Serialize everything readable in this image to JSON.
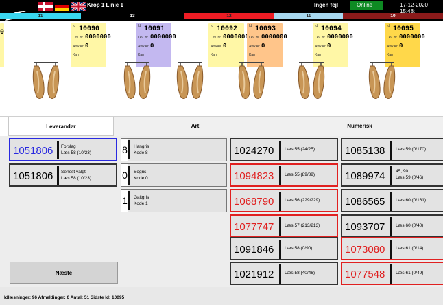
{
  "header": {
    "line_title": "Krop 1 Linie 1",
    "status": "Ingen fejl",
    "online": "Online",
    "datetime": "17-12-2020 15:48:",
    "segments": [
      "11",
      "13",
      "12",
      "11",
      "10"
    ],
    "colors": {
      "cyan": "#3ad6f0",
      "black": "#000000",
      "red": "#ee1c24",
      "light_blue": "#a8d8ef",
      "dark_red": "#8b1a1a",
      "online": "#0e8a23"
    }
  },
  "cards": [
    {
      "id": "10090",
      "lev": "0000000",
      "afskaer": "0",
      "kan": "",
      "color": "#fff7a6",
      "label_id": "Id",
      "label_lev": "Lev. nr",
      "label_afsk": "Afskær",
      "label_kan": "Kan"
    },
    {
      "id": "10091",
      "lev": "0000000",
      "afskaer": "0",
      "kan": "",
      "color": "#c3b8f0",
      "label_id": "Id",
      "label_lev": "Lev. nr",
      "label_afsk": "Afskær",
      "label_kan": "Kan"
    },
    {
      "id": "10092",
      "lev": "0000000",
      "afskaer": "0",
      "kan": "",
      "color": "#fff7a6",
      "label_id": "Id",
      "label_lev": "Lev. nr",
      "label_afsk": "Afskær",
      "label_kan": "Kan"
    },
    {
      "id": "10093",
      "lev": "0000000",
      "afskaer": "0",
      "kan": "",
      "color": "#ffc58a",
      "label_id": "Id",
      "label_lev": "Lev. nr",
      "label_afsk": "Afskær",
      "label_kan": "Kan"
    },
    {
      "id": "10094",
      "lev": "0000000",
      "afskaer": "0",
      "kan": "",
      "color": "#fff7a6",
      "label_id": "Id",
      "label_lev": "Lev. nr",
      "label_afsk": "Afskær",
      "label_kan": "Kan"
    },
    {
      "id": "10095",
      "lev": "0000000",
      "afskaer": "0",
      "kan": "",
      "color": "#ffd84a",
      "label_id": "Id",
      "label_lev": "Lev. nr",
      "label_afsk": "Afskær",
      "label_kan": "Kan"
    }
  ],
  "partial_card_value": "0",
  "tabs": [
    "Leverandør",
    "Art",
    "Numerisk"
  ],
  "supplier": {
    "forslag": {
      "number": "1051806",
      "label": "Forslag",
      "sub": "Læs 58 (10/23)"
    },
    "senest": {
      "number": "1051806",
      "label": "Senest valgt",
      "sub": "Læs 58 (10/23)"
    }
  },
  "art": [
    {
      "digit": "8",
      "name": "Hangris",
      "code": "Kode 8"
    },
    {
      "digit": "0",
      "name": "Sogris",
      "code": "Kode 0"
    },
    {
      "digit": "1",
      "name": "Galtgris",
      "code": "Kode 1"
    }
  ],
  "grid_col1": [
    {
      "number": "1024270",
      "label": "Læs 55 (24/25)",
      "red": false
    },
    {
      "number": "1094823",
      "label": "Læs 55 (89/89)",
      "red": true
    },
    {
      "number": "1068790",
      "label": "Læs 56 (229/229)",
      "red": true
    },
    {
      "number": "1077747",
      "label": "Læs 57 (213/213)",
      "red": true
    },
    {
      "number": "1091846",
      "label": "Læs 58 (0/90)",
      "red": false
    },
    {
      "number": "1021912",
      "label": "Læs 58 (40/46)",
      "red": false
    }
  ],
  "grid_col2": [
    {
      "number": "1085138",
      "label": "Læs 59 (0/170)",
      "red": false
    },
    {
      "number": "1089974",
      "label": "Læs 59 (0/46)",
      "extra": "45, 90",
      "red": false
    },
    {
      "number": "1086565",
      "label": "Læs 60 (0/161)",
      "red": false
    },
    {
      "number": "1093707",
      "label": "Læs 60 (0/40)",
      "red": false
    },
    {
      "number": "1073080",
      "label": "Læs 61 (0/14)",
      "red": true
    },
    {
      "number": "1077548",
      "label": "Læs 61 (0/49)",
      "red": true
    }
  ],
  "next_button": "Næste",
  "footer": "Idlæsninger: 96  Afmeldinger: 0  Antal: 51  Sidste Id: 10095"
}
